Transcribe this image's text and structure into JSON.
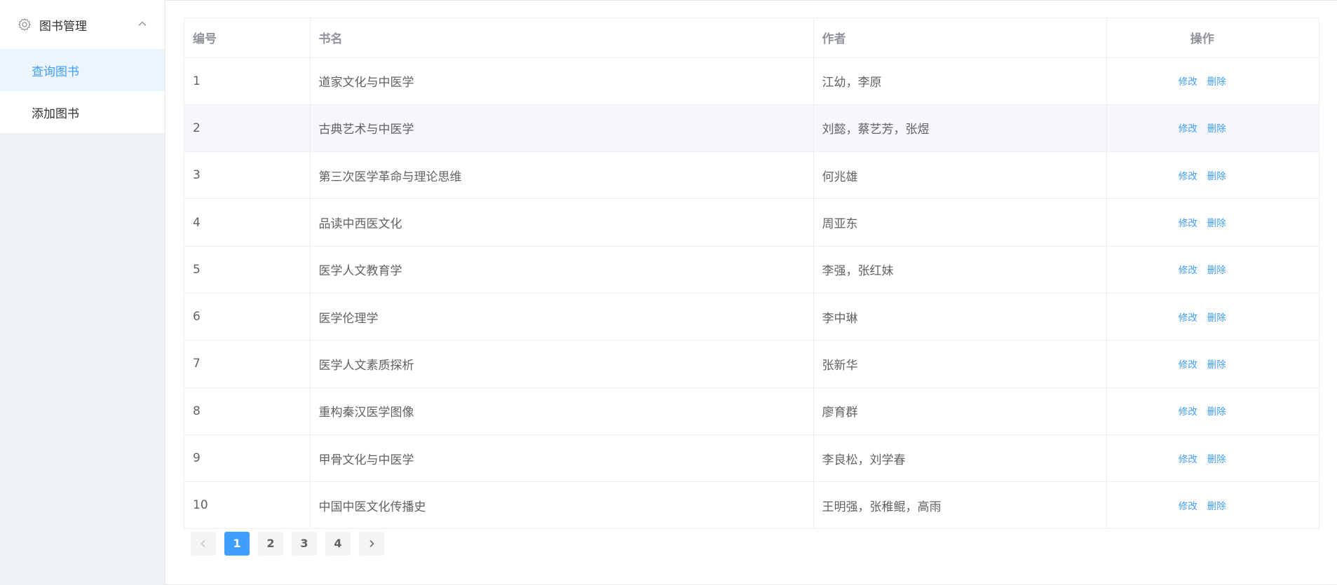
{
  "sidebar": {
    "group_title": "图书管理",
    "group_icon": "gear-icon",
    "items": [
      {
        "label": "查询图书",
        "active": true
      },
      {
        "label": "添加图书",
        "active": false
      }
    ]
  },
  "table": {
    "headers": {
      "id": "编号",
      "name": "书名",
      "author": "作者",
      "ops": "操作"
    },
    "rows": [
      {
        "id": "1",
        "name": "道家文化与中医学",
        "author": "江幼，李原"
      },
      {
        "id": "2",
        "name": "古典艺术与中医学",
        "author": "刘懿，蔡艺芳，张煜"
      },
      {
        "id": "3",
        "name": "第三次医学革命与理论思维",
        "author": "何兆雄"
      },
      {
        "id": "4",
        "name": "品读中西医文化",
        "author": "周亚东"
      },
      {
        "id": "5",
        "name": "医学人文教育学",
        "author": "李强，张红妹"
      },
      {
        "id": "6",
        "name": "医学伦理学",
        "author": "李中琳"
      },
      {
        "id": "7",
        "name": "医学人文素质探析",
        "author": "张新华"
      },
      {
        "id": "8",
        "name": "重构秦汉医学图像",
        "author": "廖育群"
      },
      {
        "id": "9",
        "name": "甲骨文化与中医学",
        "author": "李良松，刘学春"
      },
      {
        "id": "10",
        "name": "中国中医文化传播史",
        "author": "王明强，张稚鲲，高雨"
      }
    ],
    "edit_label": "修改",
    "delete_label": "删除"
  },
  "pagination": {
    "pages": [
      "1",
      "2",
      "3",
      "4"
    ],
    "current": "1",
    "prev_icon": "chevron-left-icon",
    "next_icon": "chevron-right-icon"
  },
  "colors": {
    "accent": "#409eff",
    "sidebar_bg": "#eef1f6",
    "active_item_bg": "#ecf5ff",
    "stripe_bg": "#f5f7fa"
  }
}
